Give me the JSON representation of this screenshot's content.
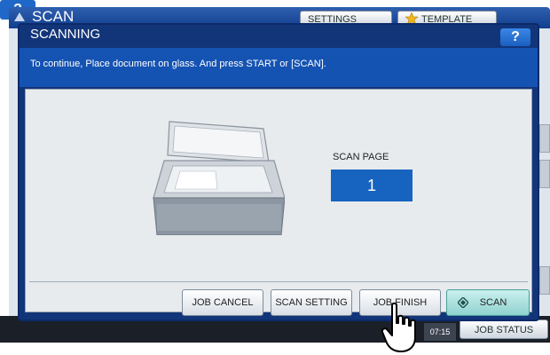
{
  "background": {
    "app_title": "SCAN",
    "settings_label": "SETTINGS",
    "template_label": "TEMPLATE",
    "help_label": "?",
    "time": "07:15",
    "job_status_label": "JOB STATUS"
  },
  "dialog": {
    "title": "SCANNING",
    "help_label": "?",
    "message": "To continue, Place document on glass. And press START or [SCAN].",
    "scan_page_label": "SCAN PAGE",
    "scan_page_value": "1",
    "buttons": {
      "job_cancel": "JOB CANCEL",
      "scan_setting": "SCAN SETTING",
      "job_finish": "JOB FINISH",
      "scan": "SCAN"
    }
  },
  "icons": [
    "scanner-icon",
    "star-icon",
    "diamond-icon",
    "hand-cursor-icon"
  ],
  "colors": {
    "dialog_frame": "#12357a",
    "message_bar": "#1553b3",
    "scan_page_box": "#1763c0",
    "scan_button": "#a8e2df"
  }
}
